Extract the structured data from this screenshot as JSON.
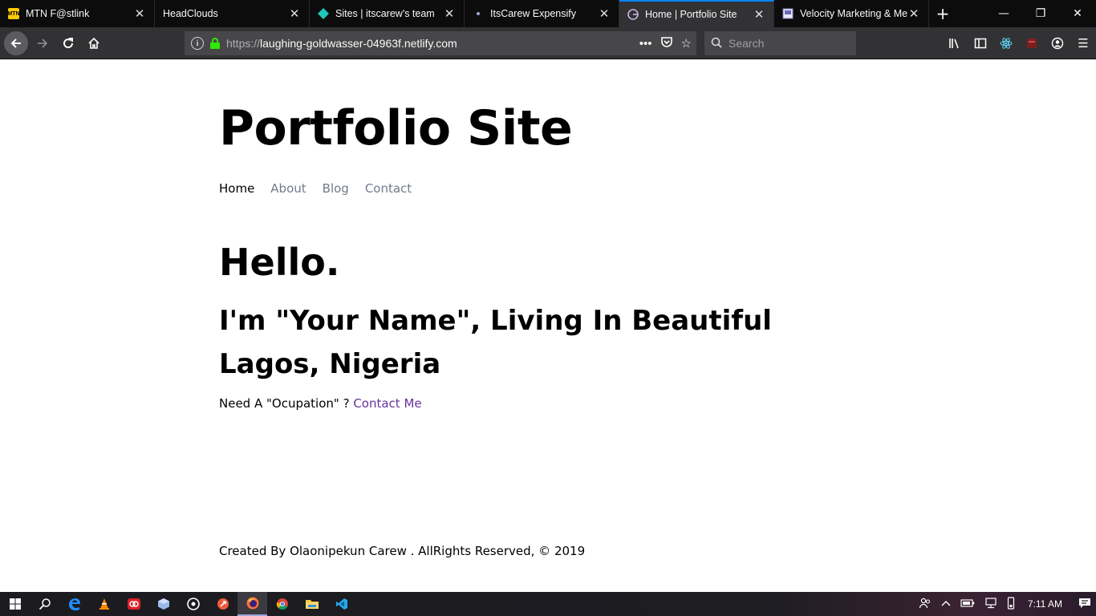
{
  "browser": {
    "tabs": [
      {
        "title": "MTN F@stlink",
        "favicon": "mtn-icon",
        "color": "#ffcc00"
      },
      {
        "title": "HeadClouds",
        "favicon": "blank-icon",
        "color": "#0c0c0d"
      },
      {
        "title": "Sites | itscarew's team",
        "favicon": "netlify-icon",
        "color": "#20c6b7"
      },
      {
        "title": "ItsCarew Expensify",
        "favicon": "dot-icon",
        "color": "#9aa7d6"
      },
      {
        "title": "Home | Portfolio Site",
        "favicon": "gatsby-icon",
        "color": "#663399",
        "active": true
      },
      {
        "title": "Velocity Marketing & Me",
        "favicon": "site-icon",
        "color": "#b1b1ff"
      }
    ],
    "url": {
      "protocol": "https://",
      "host": "laughing-goldwasser-04963f.netlify.com"
    },
    "search_placeholder": "Search"
  },
  "site": {
    "title": "Portfolio Site",
    "nav": [
      "Home",
      "About",
      "Blog",
      "Contact"
    ],
    "greeting": "Hello.",
    "intro": "I'm \"Your Name\", Living In Beautiful Lagos, Nigeria",
    "cta_text": "Need A \"Ocupation\" ?",
    "cta_link": "Contact Me",
    "footer": "Created By Olaonipekun Carew . AllRights Reserved, © 2019",
    "link_color": "#663399"
  },
  "taskbar": {
    "clock": "7:11 AM"
  }
}
